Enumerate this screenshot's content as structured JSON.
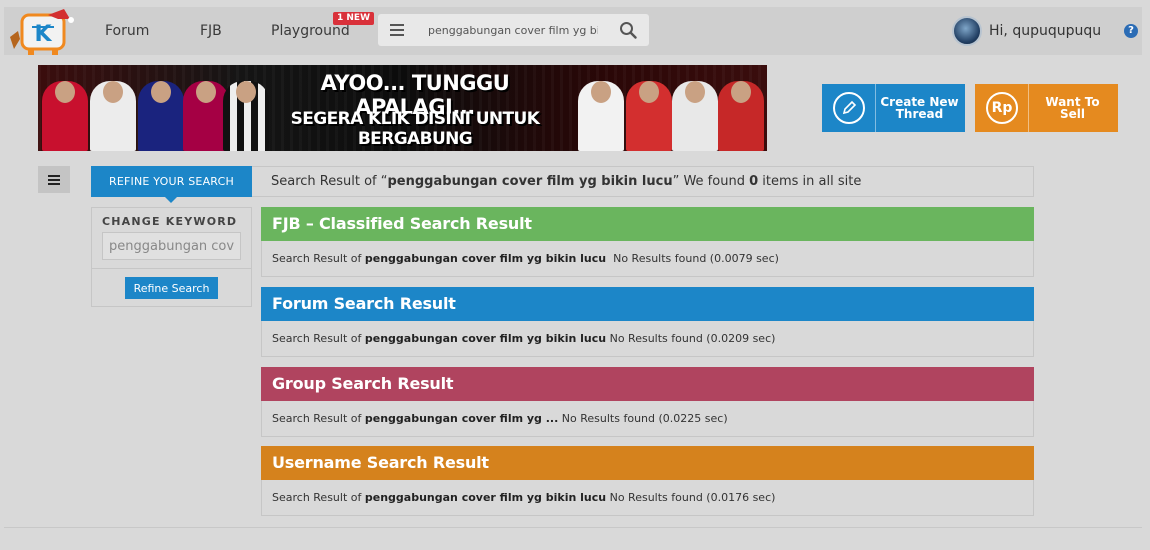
{
  "nav": {
    "forum": "Forum",
    "fjb": "FJB",
    "playground": "Playground",
    "new_badge": "1 NEW",
    "search_value": "penggabungan cover film yg bikin lucu",
    "user_greeting": "Hi, qupuqupuqu",
    "help": "?"
  },
  "banner": {
    "line1": "AYOO... TUNGGU APALAGI...",
    "line2": "SEGERA KLIK DISINI UNTUK BERGABUNG"
  },
  "actions": {
    "create_thread": "Create New Thread",
    "want_to_sell": "Want To Sell",
    "sell_icon_text": "Rp"
  },
  "sidebar": {
    "refine_tab": "REFINE YOUR SEARCH",
    "change_keyword": "CHANGE KEYWORD",
    "keyword_value": "penggabungan cover film yg bikin lucu",
    "refine_button": "Refine Search"
  },
  "result_header": {
    "prefix": "Search Result of “",
    "query": "penggabungan cover film yg bikin lucu",
    "middle": "” We found ",
    "count": "0",
    "suffix": " items in all site"
  },
  "sections": [
    {
      "title": "FJB – Classified Search Result",
      "color": "#6ab55e",
      "prefix": "Search Result of ",
      "query": "penggabungan cover film yg bikin lucu",
      "status": "  No Results found (0.0079 sec)"
    },
    {
      "title": "Forum Search Result",
      "color": "#1c86c8",
      "prefix": "Search Result of ",
      "query": "penggabungan cover film yg bikin lucu",
      "status": " No Results found (0.0209 sec)"
    },
    {
      "title": "Group Search Result",
      "color": "#b0445f",
      "prefix": "Search Result of ",
      "query": "penggabungan cover film yg ...",
      "status": " No Results found (0.0225 sec)"
    },
    {
      "title": "Username Search Result",
      "color": "#d5821d",
      "prefix": "Search Result of ",
      "query": "penggabungan cover film yg bikin lucu",
      "status": " No Results found (0.0176 sec)"
    }
  ],
  "colors": {
    "primary_blue": "#1c86c8",
    "sell_orange": "#e58a1f",
    "badge_red": "#d9313a"
  }
}
